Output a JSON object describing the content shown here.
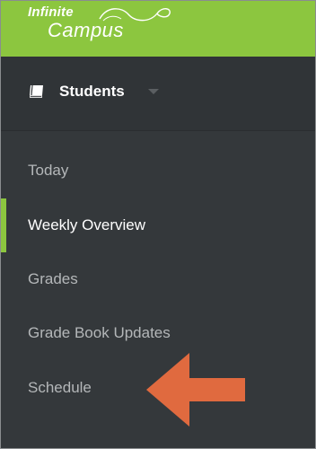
{
  "brand": {
    "line1": "Infinite",
    "line2": "Campus",
    "bar_color": "#8cc63f"
  },
  "header": {
    "icon": "book-icon",
    "title": "Students",
    "dropdown_icon": "caret-down-icon"
  },
  "nav": {
    "items": [
      {
        "label": "Today",
        "active": false
      },
      {
        "label": "Weekly Overview",
        "active": true
      },
      {
        "label": "Grades",
        "active": false
      },
      {
        "label": "Grade Book Updates",
        "active": false
      },
      {
        "label": "Schedule",
        "active": false
      }
    ]
  },
  "annotation": {
    "icon": "left-arrow-icon",
    "color": "#e06a3f"
  },
  "colors": {
    "sidebar_bg": "#34383b",
    "accent": "#8cc63f",
    "text_muted": "#b4b7b9",
    "text_active": "#ffffff"
  }
}
